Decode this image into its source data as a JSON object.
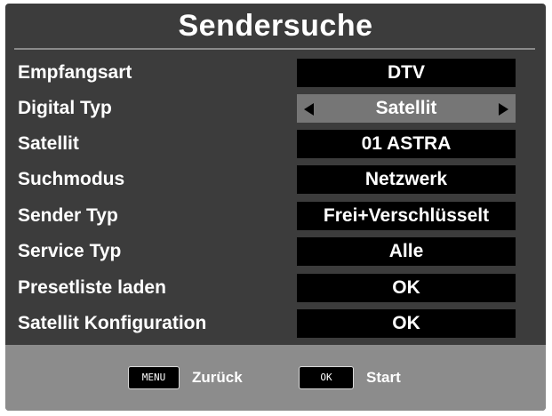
{
  "title": "Sendersuche",
  "settings": [
    {
      "label": "Empfangsart",
      "value": "DTV"
    },
    {
      "label": "Digital Typ",
      "value": "Satellit",
      "selected": true
    },
    {
      "label": "Satellit",
      "value": "01 ASTRA"
    },
    {
      "label": "Suchmodus",
      "value": "Netzwerk"
    },
    {
      "label": "Sender Typ",
      "value": "Frei+Verschlüsselt"
    },
    {
      "label": "Service Typ",
      "value": "Alle"
    },
    {
      "label": "Presetliste laden",
      "value": "OK"
    },
    {
      "label": "Satellit Konfiguration",
      "value": "OK"
    }
  ],
  "footer": {
    "back": {
      "key": "MENU",
      "label": "Zurück"
    },
    "start": {
      "key": "OK",
      "label": "Start"
    }
  },
  "icons": {
    "left": "arrow-left-icon",
    "right": "arrow-right-icon"
  },
  "colors": {
    "panel": "#3c3c3c",
    "value_box": "#000000",
    "selected_value_box": "#767676",
    "footer": "#8c8c8c",
    "text": "#ffffff"
  }
}
